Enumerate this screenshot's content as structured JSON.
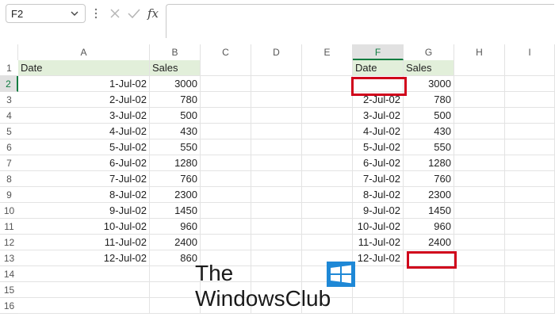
{
  "formula_bar": {
    "name_box": "F2",
    "formula_value": "",
    "fx_label": "fx",
    "cancel_icon": "x-icon",
    "enter_icon": "check-icon"
  },
  "columns": [
    "A",
    "B",
    "C",
    "D",
    "E",
    "F",
    "G",
    "H",
    "I"
  ],
  "rows": [
    "1",
    "2",
    "3",
    "4",
    "5",
    "6",
    "7",
    "8",
    "9",
    "10",
    "11",
    "12",
    "13",
    "14",
    "15",
    "16"
  ],
  "sheet": {
    "left_table": {
      "header": {
        "date": "Date",
        "sales": "Sales"
      },
      "rows": [
        {
          "date": "1-Jul-02",
          "sales": "3000"
        },
        {
          "date": "2-Jul-02",
          "sales": "780"
        },
        {
          "date": "3-Jul-02",
          "sales": "500"
        },
        {
          "date": "4-Jul-02",
          "sales": "430"
        },
        {
          "date": "5-Jul-02",
          "sales": "550"
        },
        {
          "date": "6-Jul-02",
          "sales": "1280"
        },
        {
          "date": "7-Jul-02",
          "sales": "760"
        },
        {
          "date": "8-Jul-02",
          "sales": "2300"
        },
        {
          "date": "9-Jul-02",
          "sales": "1450"
        },
        {
          "date": "10-Jul-02",
          "sales": "960"
        },
        {
          "date": "11-Jul-02",
          "sales": "2400"
        },
        {
          "date": "12-Jul-02",
          "sales": "860"
        }
      ]
    },
    "right_table": {
      "header": {
        "date": "Date",
        "sales": "Sales"
      },
      "rows": [
        {
          "date": "",
          "sales": "3000"
        },
        {
          "date": "2-Jul-02",
          "sales": "780"
        },
        {
          "date": "3-Jul-02",
          "sales": "500"
        },
        {
          "date": "4-Jul-02",
          "sales": "430"
        },
        {
          "date": "5-Jul-02",
          "sales": "550"
        },
        {
          "date": "6-Jul-02",
          "sales": "1280"
        },
        {
          "date": "7-Jul-02",
          "sales": "760"
        },
        {
          "date": "8-Jul-02",
          "sales": "2300"
        },
        {
          "date": "9-Jul-02",
          "sales": "1450"
        },
        {
          "date": "10-Jul-02",
          "sales": "960"
        },
        {
          "date": "11-Jul-02",
          "sales": "2400"
        },
        {
          "date": "12-Jul-02",
          "sales": ""
        }
      ]
    }
  },
  "watermark": {
    "line1": "The",
    "line2": "WindowsClub"
  },
  "colors": {
    "selected_header": "#107c41",
    "highlight_box": "#d0021b",
    "table_header_fill": "#e2efda"
  }
}
